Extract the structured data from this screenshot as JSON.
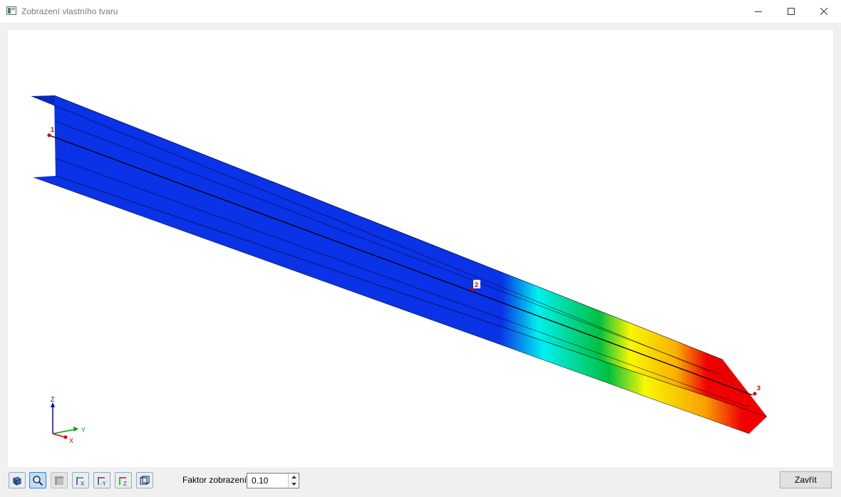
{
  "window": {
    "title": "Zobrazení vlastního tvaru",
    "icons": {
      "app": "window-app-icon",
      "minimize": "minimize-icon",
      "maximize": "maximize-icon",
      "close": "close-icon"
    }
  },
  "viewport": {
    "node_labels": [
      "1",
      "2",
      "3"
    ],
    "axes": {
      "x": "X",
      "y": "Y",
      "z": "Z"
    },
    "colors": {
      "background": "#ffffff",
      "beam_base": "#0a32e6",
      "beam_dark": "#061c9a",
      "ramp": [
        "#0a32e6",
        "#00f0f0",
        "#00c040",
        "#f8f800",
        "#f8b000",
        "#f00000"
      ],
      "node_marker": "#cc0000",
      "axis_x": "#d00000",
      "axis_y": "#00a000",
      "axis_z": "#0000c0"
    }
  },
  "toolbar": {
    "buttons": [
      {
        "name": "view-iso-icon",
        "state": "normal"
      },
      {
        "name": "zoom-icon",
        "state": "active"
      },
      {
        "name": "render-mode-icon",
        "state": "disabled"
      },
      {
        "name": "view-x-icon",
        "state": "normal"
      },
      {
        "name": "view-minus-y-icon",
        "state": "normal"
      },
      {
        "name": "view-z-icon",
        "state": "normal"
      },
      {
        "name": "view-3d-box-icon",
        "state": "normal"
      }
    ],
    "factor_label": "Faktor zobrazení:",
    "factor_value": "0.10",
    "close_label": "Zavřít"
  }
}
